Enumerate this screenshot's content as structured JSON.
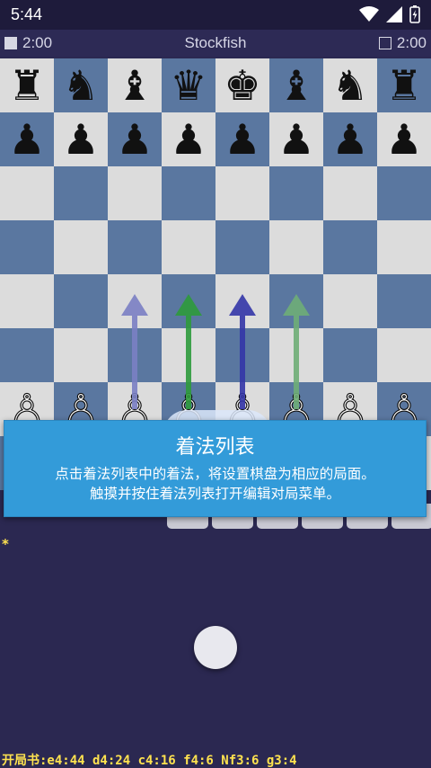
{
  "status_bar": {
    "time": "5:44"
  },
  "title_bar": {
    "left_clock": "2:00",
    "right_clock": "2:00",
    "title": "Stockfish"
  },
  "board": {
    "ranks": [
      [
        "♜",
        "♞",
        "♝",
        "♛",
        "♚",
        "♝",
        "♞",
        "♜"
      ],
      [
        "♟",
        "♟",
        "♟",
        "♟",
        "♟",
        "♟",
        "♟",
        "♟"
      ],
      [
        "",
        "",
        "",
        "",
        "",
        "",
        "",
        ""
      ],
      [
        "",
        "",
        "",
        "",
        "",
        "",
        "",
        ""
      ],
      [
        "",
        "",
        "",
        "",
        "",
        "",
        "",
        ""
      ],
      [
        "",
        "",
        "",
        "",
        "",
        "",
        "",
        ""
      ],
      [
        "♙",
        "♙",
        "♙",
        "♙",
        "♙",
        "♙",
        "♙",
        "♙"
      ],
      [
        "♖",
        "♘",
        "♗",
        "♕",
        "♔",
        "♗",
        "♘",
        "♖"
      ]
    ],
    "arrows": [
      {
        "from": "c2",
        "to": "c4",
        "color": "#7b80c4"
      },
      {
        "from": "d2",
        "to": "d4",
        "color": "#2e9b3c"
      },
      {
        "from": "e2",
        "to": "e4",
        "color": "#3436a8"
      },
      {
        "from": "f2",
        "to": "f4",
        "color": "#6fae77"
      }
    ]
  },
  "tooltip": {
    "title": "着法列表",
    "line1": "点击着法列表中的着法，将设置棋盘为相应的局面。",
    "line2": "触摸并按住着法列表打开编辑对局菜单。"
  },
  "move_list": {
    "marker": "*"
  },
  "book_line": "开局书:e4:44 d4:24 c4:16 f4:6 Nf3:6 g3:4",
  "colors": {
    "light_square": "#dcdcdc",
    "dark_square": "#5a77a0",
    "background": "#2b2851",
    "tooltip": "#339bd9",
    "book_text": "#ffe34f"
  }
}
